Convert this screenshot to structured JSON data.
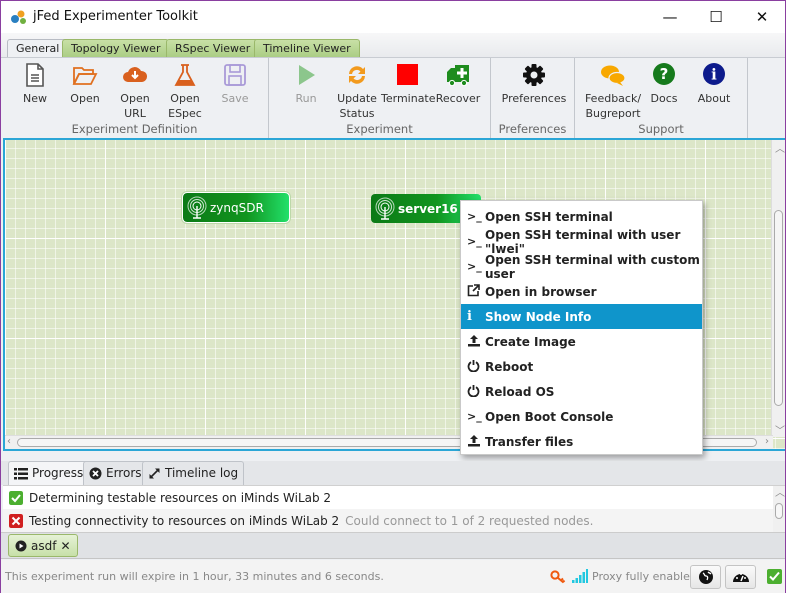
{
  "window": {
    "title": "jFed Experimenter Toolkit",
    "controls": {
      "minimize": "—",
      "maximize": "☐",
      "close": "✕"
    }
  },
  "tabs": [
    {
      "label": "General",
      "active": true
    },
    {
      "label": "Topology Viewer",
      "active": false
    },
    {
      "label": "RSpec Viewer",
      "active": false
    },
    {
      "label": "Timeline Viewer",
      "active": false
    }
  ],
  "ribbon": {
    "groups": [
      {
        "label": "Experiment Definition"
      },
      {
        "label": "Experiment"
      },
      {
        "label": "Preferences"
      },
      {
        "label": "Support"
      }
    ],
    "buttons": {
      "new": {
        "label": "New",
        "icon": "document-icon"
      },
      "open": {
        "label": "Open",
        "icon": "folder-open-icon"
      },
      "open_url": {
        "label": "Open\nURL",
        "line1": "Open",
        "line2": "URL",
        "icon": "cloud-download-icon"
      },
      "open_espec": {
        "label": "Open ESpec",
        "line1": "Open",
        "line2": "ESpec",
        "icon": "flask-icon"
      },
      "save": {
        "label": "Save",
        "icon": "floppy-icon",
        "disabled": true
      },
      "run": {
        "label": "Run",
        "icon": "play-icon",
        "disabled": true
      },
      "update_status": {
        "label": "Update Status",
        "line1": "Update",
        "line2": "Status",
        "icon": "refresh-icon"
      },
      "terminate": {
        "label": "Terminate",
        "icon": "stop-square-icon"
      },
      "recover": {
        "label": "Recover",
        "icon": "ambulance-icon"
      },
      "preferences": {
        "label": "Preferences",
        "icon": "gear-icon"
      },
      "feedback": {
        "label": "Feedback/ Bugreport",
        "line1": "Feedback/",
        "line2": "Bugreport",
        "icon": "chat-bubbles-icon"
      },
      "docs": {
        "label": "Docs",
        "icon": "question-circle-icon"
      },
      "about": {
        "label": "About",
        "icon": "info-circle-icon"
      }
    }
  },
  "topology": {
    "nodes": [
      {
        "label": "zynqSDR",
        "icon": "antenna-icon",
        "selected": true
      },
      {
        "label": "server16",
        "icon": "antenna-icon",
        "selected": false
      }
    ]
  },
  "context_menu": {
    "items": [
      {
        "label": "Open SSH terminal",
        "icon": "terminal-icon",
        "glyph": ">_"
      },
      {
        "label": "Open SSH terminal with user \"lwei\"",
        "icon": "terminal-icon",
        "glyph": ">_"
      },
      {
        "label": "Open SSH terminal with custom user",
        "icon": "terminal-icon",
        "glyph": ">_"
      },
      {
        "label": "Open in browser",
        "icon": "external-link-icon",
        "glyph": "↗"
      },
      {
        "label": "Show Node Info",
        "icon": "info-icon",
        "glyph": "i",
        "highlighted": true
      },
      {
        "label": "Create Image",
        "icon": "upload-icon",
        "glyph": "⇧"
      },
      {
        "label": "Reboot",
        "icon": "power-icon",
        "glyph": "⏻"
      },
      {
        "label": "Reload OS",
        "icon": "power-icon",
        "glyph": "⏻"
      },
      {
        "label": "Open Boot Console",
        "icon": "terminal-icon",
        "glyph": ">_"
      },
      {
        "label": "Transfer files",
        "icon": "upload-icon",
        "glyph": "⇧"
      }
    ]
  },
  "bottom_tabs": [
    {
      "label": "Progress",
      "icon": "list-icon",
      "active": true
    },
    {
      "label": "Errors",
      "icon": "error-circle-icon",
      "active": false
    },
    {
      "label": "Timeline log",
      "icon": "expand-arrows-icon",
      "active": false
    }
  ],
  "progress": [
    {
      "status": "success",
      "text": "Determining testable resources on iMinds WiLab 2",
      "detail": ""
    },
    {
      "status": "failure",
      "text": "Testing connectivity to resources on iMinds WiLab 2",
      "detail": "Could connect to 1 of 2 requested nodes."
    }
  ],
  "run_tab": {
    "label": "asdf",
    "close": "✕"
  },
  "status": {
    "expiry_text": "This experiment run will expire in 1 hour, 33 minutes and 6 seconds.",
    "proxy_text": "Proxy fully enabled"
  },
  "colors": {
    "accent": "#0f95cb",
    "node_green": "#11951f",
    "tab_green": "#a9cc82",
    "canvas_bg": "#dce6c8",
    "terminate_red": "#ff0000"
  }
}
